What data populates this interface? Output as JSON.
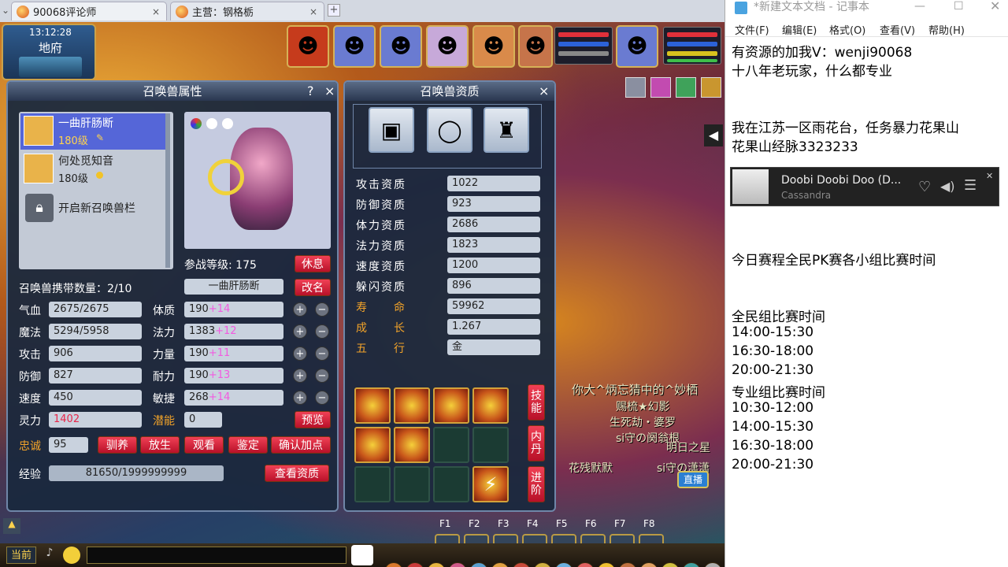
{
  "browser": {
    "tabs": [
      {
        "title": "90068评论师",
        "close": "×"
      },
      {
        "title": "主营：钢格栃",
        "close": "×"
      }
    ],
    "new_tab": "+"
  },
  "hud": {
    "time": "13:12:28",
    "map": "地府"
  },
  "pet_panel": {
    "title": "召唤兽属性",
    "help": "?",
    "close": "×",
    "pets": [
      {
        "name": "一曲肝肠断",
        "level": "180级",
        "selected": true
      },
      {
        "name": "何处觅知音",
        "level": "180级",
        "selected": false
      }
    ],
    "unlock_label": "开启新召唤兽栏",
    "battle_level_label": "参战等级: 175",
    "rest_button": "休息",
    "carry_label": "召唤兽携带数量：2/10",
    "name_value": "一曲肝肠断",
    "rename_button": "改名",
    "stats_left": [
      {
        "label": "气血",
        "value": "2675/2675"
      },
      {
        "label": "魔法",
        "value": "5294/5958"
      },
      {
        "label": "攻击",
        "value": "906"
      },
      {
        "label": "防御",
        "value": "827"
      },
      {
        "label": "速度",
        "value": "450"
      },
      {
        "label": "灵力",
        "value": "1402"
      }
    ],
    "stats_right": [
      {
        "label": "体质",
        "base": "190",
        "bonus": "+14"
      },
      {
        "label": "法力",
        "base": "1383",
        "bonus": "+12"
      },
      {
        "label": "力量",
        "base": "190",
        "bonus": "+11"
      },
      {
        "label": "耐力",
        "base": "190",
        "bonus": "+13"
      },
      {
        "label": "敏捷",
        "base": "268",
        "bonus": "+14"
      }
    ],
    "plus": "+",
    "minus": "−",
    "potential_label": "潜能",
    "potential_value": "0",
    "preview_button": "预览",
    "loyalty_label": "忠诚",
    "loyalty_value": "95",
    "buttons": [
      "驯养",
      "放生",
      "观看",
      "鉴定",
      "确认加点"
    ],
    "exp_label": "经验",
    "exp_value": "81650/1999999999",
    "view_aptitude_button": "查看资质"
  },
  "aptitude_panel": {
    "title": "召唤兽资质",
    "close": "×",
    "rows": [
      {
        "label": "攻击资质",
        "value": "1022",
        "orange": false
      },
      {
        "label": "防御资质",
        "value": "923",
        "orange": false
      },
      {
        "label": "体力资质",
        "value": "2686",
        "orange": false
      },
      {
        "label": "法力资质",
        "value": "1823",
        "orange": false
      },
      {
        "label": "速度资质",
        "value": "1200",
        "orange": false
      },
      {
        "label": "躲闪资质",
        "value": "896",
        "orange": false
      },
      {
        "label": "寿　　命",
        "value": "59962",
        "orange": true
      },
      {
        "label": "成　　长",
        "value": "1.267",
        "orange": true
      },
      {
        "label": "五　　行",
        "value": "金",
        "orange": true
      }
    ],
    "side_buttons": [
      "技能",
      "内丹",
      "进阶"
    ]
  },
  "hotkeys": [
    "F1",
    "F2",
    "F3",
    "F4",
    "F5",
    "F6",
    "F7",
    "F8"
  ],
  "chat": {
    "channel": "当前",
    "floating_texts": [
      "你大^炳忘猜中的^妙栖",
      "赐梳★幻影",
      "生死劫・婆罗",
      "si守の阕翁根",
      "明日之星",
      "花残默默",
      "si守の潇潇"
    ]
  },
  "badge": "直播",
  "notepad": {
    "title": "*新建文本文档 - 记事本",
    "menu": [
      "文件(F)",
      "编辑(E)",
      "格式(O)",
      "查看(V)",
      "帮助(H)"
    ],
    "lines_top": [
      "有资源的加我V：wenji90068",
      "十八年老玩家，什么都专业",
      "",
      "",
      "我在江苏一区雨花台，任务暴力花果山",
      "花果山经脉3323233"
    ],
    "music": {
      "title": "Doobi Doobi Doo (D...",
      "artist": "Cassandra"
    },
    "lines_bottom": [
      "今日赛程全民PK赛各小组比赛时间",
      "",
      "",
      "全民组比赛时间",
      "14:00-15:30",
      "16:30-18:00",
      "20:00-21:30",
      "专业组比赛时间",
      "10:30-12:00",
      "14:00-15:30",
      "16:30-18:00",
      "20:00-21:30"
    ]
  },
  "colors": {
    "accent_red": "#d8203a",
    "panel_bg": "#1a283e",
    "orange_text": "#f2a329",
    "bonus_pink": "#f25ae0"
  }
}
